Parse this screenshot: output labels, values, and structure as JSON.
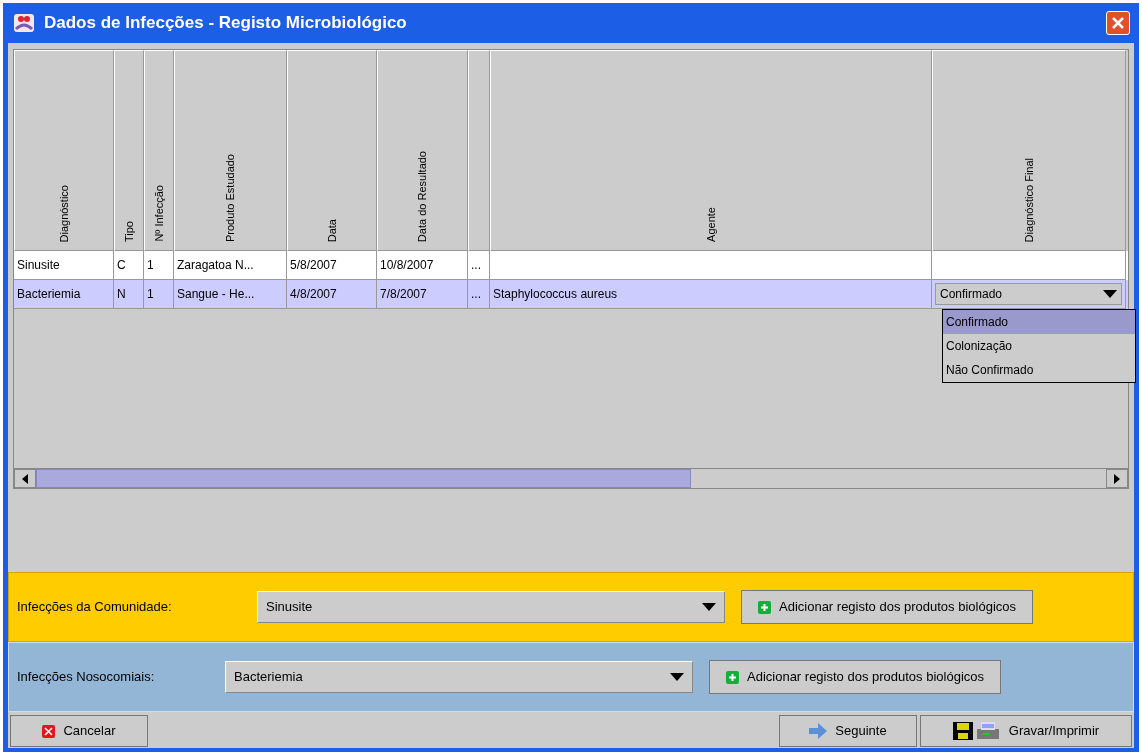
{
  "window": {
    "title": "Dados de Infecções - Registo Microbiológico"
  },
  "table": {
    "columns": [
      "Diagnóstico",
      "Tipo",
      "Nº Infecção",
      "Produto Estudado",
      "Data",
      "Data do Resultado",
      "",
      "Agente",
      "Diagnóstico Final"
    ],
    "rows": [
      {
        "selected": false,
        "cells": [
          "Sinusite",
          "C",
          "1",
          "Zaragatoa N...",
          "5/8/2007",
          "10/8/2007",
          "...",
          "",
          ""
        ]
      },
      {
        "selected": true,
        "cells": [
          "Bacteriemia",
          "N",
          "1",
          "Sangue - He...",
          "4/8/2007",
          "7/8/2007",
          "...",
          "Staphylococcus aureus",
          "Confirmado"
        ],
        "dropdown_options": [
          {
            "label": "Confirmado",
            "selected": true
          },
          {
            "label": "Colonização",
            "selected": false
          },
          {
            "label": "Não Confirmado",
            "selected": false
          }
        ]
      }
    ]
  },
  "community": {
    "label": "Infecções da Comunidade:",
    "value": "Sinusite",
    "button": "Adicionar registo dos produtos biológicos"
  },
  "nosocomial": {
    "label": "Infecções Nosocomiais:",
    "value": "Bacteriemia",
    "button": "Adicionar registo dos produtos biológicos"
  },
  "buttons": {
    "cancel": "Cancelar",
    "next": "Seguinte",
    "save": "Gravar/Imprimir"
  }
}
